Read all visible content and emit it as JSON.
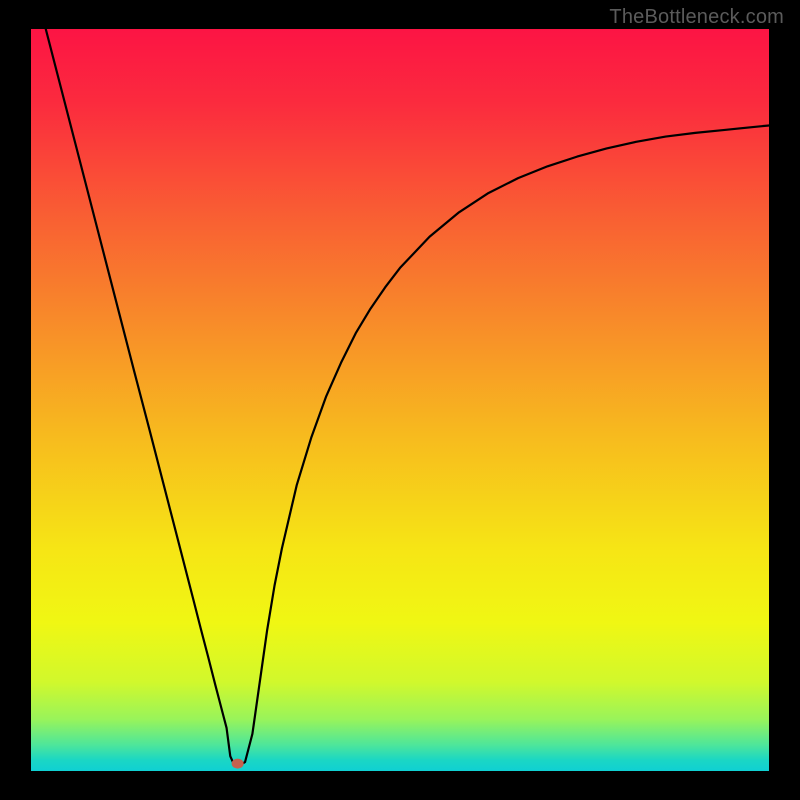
{
  "watermark": "TheBottleneck.com",
  "chart_data": {
    "type": "line",
    "title": "",
    "xlabel": "",
    "ylabel": "",
    "xlim": [
      0,
      100
    ],
    "ylim": [
      0,
      100
    ],
    "grid": false,
    "curve_minimum_x": 27,
    "marker": {
      "x": 28,
      "y": 1,
      "color": "#c4614f"
    },
    "series": [
      {
        "name": "bottleneck-curve",
        "color": "#000000",
        "x": [
          0,
          2,
          4,
          6,
          8,
          10,
          12,
          14,
          16,
          18,
          20,
          22,
          23,
          24,
          25,
          25.5,
          26,
          26.5,
          27,
          27.5,
          28,
          29,
          30,
          31,
          32,
          33,
          34,
          36,
          38,
          40,
          42,
          44,
          46,
          48,
          50,
          54,
          58,
          62,
          66,
          70,
          74,
          78,
          82,
          86,
          90,
          94,
          98,
          100
        ],
        "values": [
          108,
          100,
          92.3,
          84.6,
          76.9,
          69.2,
          61.5,
          53.8,
          46.2,
          38.5,
          30.8,
          23.1,
          19.2,
          15.4,
          11.5,
          9.6,
          7.7,
          5.8,
          2.0,
          0.9,
          0.6,
          1.2,
          5,
          12,
          19,
          25,
          30,
          38.5,
          45,
          50.5,
          55,
          59,
          62.3,
          65.2,
          67.8,
          72,
          75.3,
          77.9,
          79.9,
          81.5,
          82.8,
          83.9,
          84.8,
          85.5,
          86,
          86.4,
          86.8,
          87
        ]
      }
    ],
    "background_gradient": {
      "stops": [
        {
          "offset": 0.0,
          "color": "#fc1444"
        },
        {
          "offset": 0.1,
          "color": "#fb2b3e"
        },
        {
          "offset": 0.25,
          "color": "#f95e33"
        },
        {
          "offset": 0.4,
          "color": "#f88d29"
        },
        {
          "offset": 0.55,
          "color": "#f7bb1e"
        },
        {
          "offset": 0.7,
          "color": "#f6e515"
        },
        {
          "offset": 0.8,
          "color": "#f0f713"
        },
        {
          "offset": 0.88,
          "color": "#d1f82c"
        },
        {
          "offset": 0.93,
          "color": "#99f45a"
        },
        {
          "offset": 0.965,
          "color": "#4de69b"
        },
        {
          "offset": 0.985,
          "color": "#1bd7c4"
        },
        {
          "offset": 1.0,
          "color": "#0fd0d3"
        }
      ]
    }
  }
}
